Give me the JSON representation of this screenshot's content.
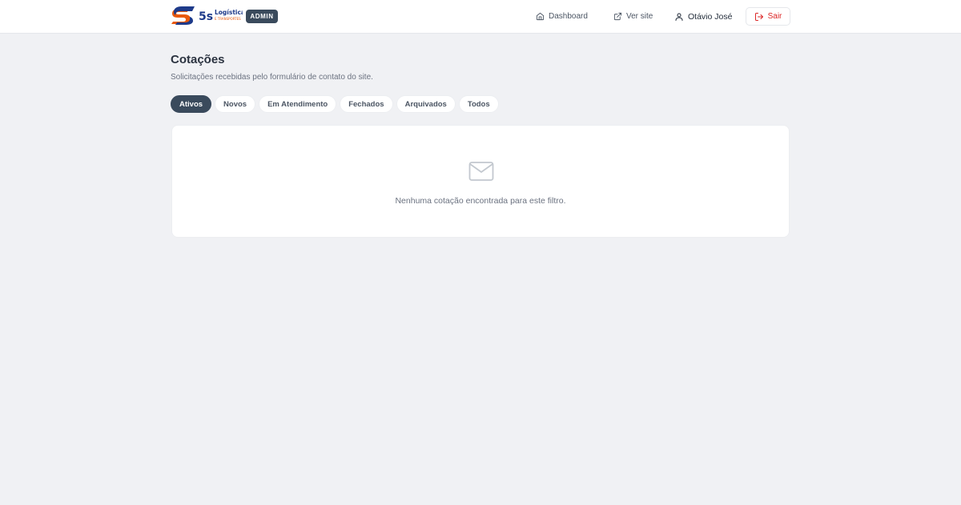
{
  "header": {
    "brand": {
      "logo_mark": "5S",
      "logo_text": "5s",
      "logo_name": "Logística",
      "logo_tagline": "E TRANSPORTES"
    },
    "admin_badge": "ADMIN",
    "nav": {
      "dashboard_label": "Dashboard",
      "dashboard_icon": "home-icon",
      "site_label": "Ver site",
      "site_icon": "external-link-icon",
      "user_name": "Otávio José",
      "user_icon": "user-icon",
      "logout_label": "Sair",
      "logout_icon": "logout-icon"
    },
    "colors": {
      "primary": "#3a4a5c",
      "logout": "#dc2626",
      "logo_blue": "#1e3a8a",
      "logo_orange": "#e8590c"
    }
  },
  "main": {
    "title": "Cotações",
    "subtitle": "Solicitações recebidas pelo formulário de contato do site.",
    "tabs": [
      {
        "label": "Ativos",
        "active": true
      },
      {
        "label": "Novos",
        "active": false
      },
      {
        "label": "Em Atendimento",
        "active": false
      },
      {
        "label": "Fechados",
        "active": false
      },
      {
        "label": "Arquivados",
        "active": false
      },
      {
        "label": "Todos",
        "active": false
      }
    ],
    "empty_state": {
      "icon": "mail-icon",
      "message": "Nenhuma cotação encontrada para este filtro."
    }
  }
}
